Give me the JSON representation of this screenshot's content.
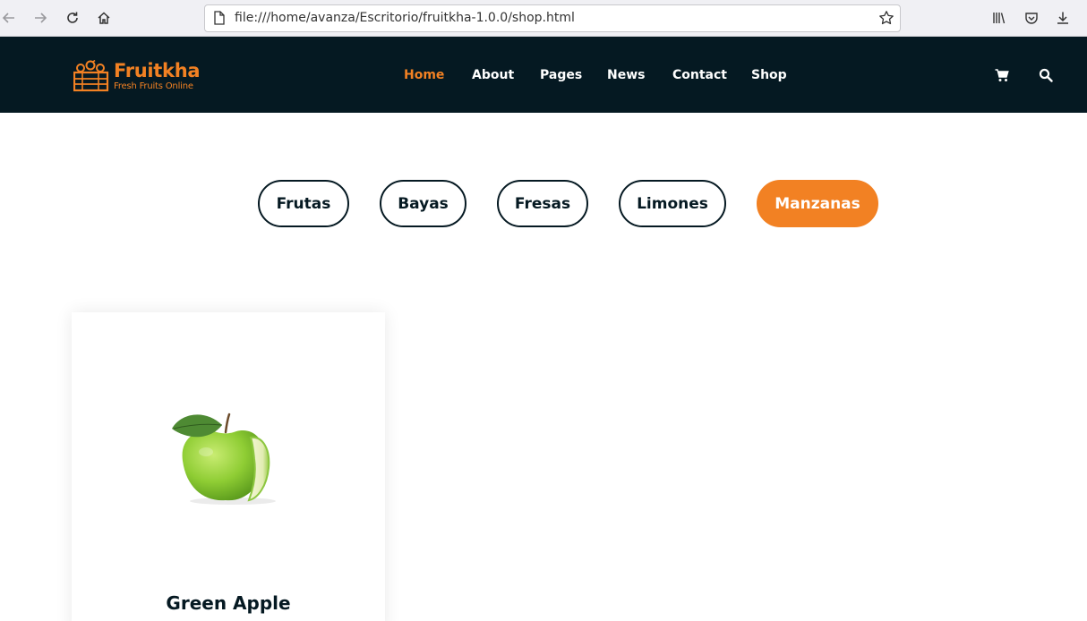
{
  "browser": {
    "url": "file:///home/avanza/Escritorio/fruitkha-1.0.0/shop.html"
  },
  "header": {
    "logo_title": "Fruitkha",
    "logo_subtitle": "Fresh Fruits Online",
    "nav": [
      {
        "label": "Home",
        "active": true
      },
      {
        "label": "About",
        "active": false
      },
      {
        "label": "Pages",
        "active": false
      },
      {
        "label": "News",
        "active": false
      },
      {
        "label": "Contact",
        "active": false
      },
      {
        "label": "Shop",
        "active": false
      }
    ]
  },
  "filters": [
    {
      "label": "Frutas",
      "active": false
    },
    {
      "label": "Bayas",
      "active": false
    },
    {
      "label": "Fresas",
      "active": false
    },
    {
      "label": "Limones",
      "active": false
    },
    {
      "label": "Manzanas",
      "active": true
    }
  ],
  "products": [
    {
      "name": "Green Apple",
      "image": "green-apple"
    }
  ],
  "colors": {
    "accent": "#f28123",
    "header_bg": "#051922",
    "text_dark": "#051922"
  }
}
